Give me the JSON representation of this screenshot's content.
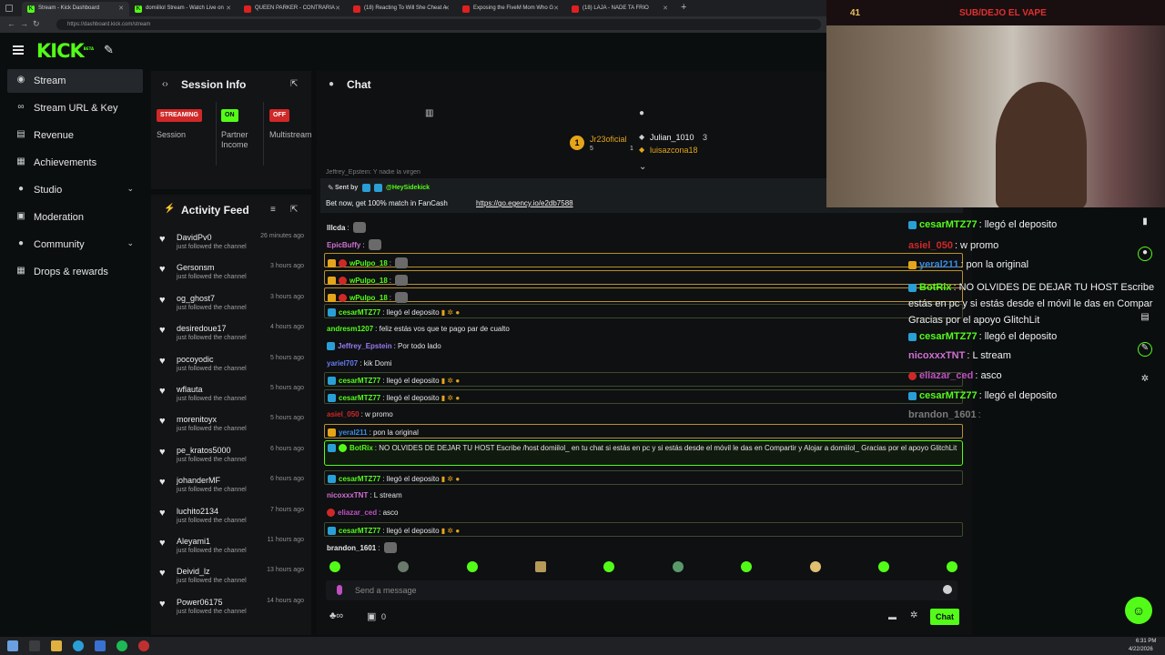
{
  "browser": {
    "tabs": [
      {
        "label": "Stream - Kick Dashboard",
        "active": true
      },
      {
        "label": "domiiliol Stream - Watch Live on",
        "active": false
      },
      {
        "label": "QUEEN PARKER - CONTRARIA",
        "active": false
      },
      {
        "label": "(18) Reacting To Will She Cheat A",
        "active": false
      },
      {
        "label": "Exposing the FiveM Mom Who G",
        "active": false
      },
      {
        "label": "(18) LAJA - NADE TA FRIO",
        "active": false
      }
    ],
    "url": "https://dashboard.kick.com/stream"
  },
  "kick": {
    "logo": "KICK",
    "logo_sup": "BETA"
  },
  "sidebar": {
    "items": [
      {
        "label": "Stream",
        "icon": "broadcast-icon"
      },
      {
        "label": "Stream URL & Key",
        "icon": "link-icon"
      },
      {
        "label": "Revenue",
        "icon": "dollar-icon"
      },
      {
        "label": "Achievements",
        "icon": "trophy-icon"
      },
      {
        "label": "Studio",
        "icon": "studio-icon"
      },
      {
        "label": "Moderation",
        "icon": "shield-icon"
      },
      {
        "label": "Community",
        "icon": "community-icon"
      },
      {
        "label": "Drops & rewards",
        "icon": "gift-icon"
      }
    ]
  },
  "session": {
    "title": "Session Info",
    "items": [
      {
        "badge": "STREAMING",
        "label": "Session",
        "color": "#d02828"
      },
      {
        "badge": "ON",
        "label": "Partner Income",
        "color": "#53fc18"
      },
      {
        "badge": "OFF",
        "label": "Multistream",
        "color": "#d02828"
      }
    ]
  },
  "activity": {
    "title": "Activity Feed",
    "sub": "just followed the channel",
    "rows": [
      {
        "name": "DavidPv0",
        "time": "26 minutes ago"
      },
      {
        "name": "Gersonsm",
        "time": "3 hours ago"
      },
      {
        "name": "og_ghost7",
        "time": "3 hours ago"
      },
      {
        "name": "desiredoue17",
        "time": "4 hours ago"
      },
      {
        "name": "pocoyodic",
        "time": "5 hours ago"
      },
      {
        "name": "wflauta",
        "time": "5 hours ago"
      },
      {
        "name": "morenitoyx",
        "time": "5 hours ago"
      },
      {
        "name": "pe_kratos5000",
        "time": "6 hours ago"
      },
      {
        "name": "johanderMF",
        "time": "6 hours ago"
      },
      {
        "name": "luchito2134",
        "time": "7 hours ago"
      },
      {
        "name": "Aleyami1",
        "time": "11 hours ago"
      },
      {
        "name": "Deivid_lz",
        "time": "13 hours ago"
      },
      {
        "name": "Power06175",
        "time": "14 hours ago"
      }
    ]
  },
  "chat": {
    "title": "Chat",
    "top_gifters": {
      "first": {
        "name": "Jr23oficial",
        "count": "5"
      },
      "second": {
        "name": "Julian_1010",
        "count": "3"
      },
      "third": {
        "name": "luisazcona18",
        "count": "1"
      }
    },
    "partial_top": "Jeffrey_Epstein: Y nadie la virgen",
    "pinned": {
      "sent_by": "Sent by",
      "sender": "@HeySidekick",
      "text": "Bet now, get 100% match in FanCash",
      "link": "https://go.egency.io/e2db7588"
    },
    "messages": [
      {
        "name": "lllcda",
        "text": "",
        "color": "#e8e8e8"
      },
      {
        "name": "EpicBuffy",
        "text": "",
        "color": "#d070d0"
      },
      {
        "name": "wPulpo_18",
        "text": "",
        "color": "#53fc18"
      },
      {
        "name": "wPulpo_18",
        "text": "",
        "color": "#53fc18"
      },
      {
        "name": "wPulpo_18",
        "text": "",
        "color": "#53fc18"
      },
      {
        "name": "cesarMTZ77",
        "text": "llegó el deposito",
        "color": "#53fc18"
      },
      {
        "name": "andresm1207",
        "text": "feliz estás vos que te pago par de cualto",
        "color": "#53fc18"
      },
      {
        "name": "Jeffrey_Epstein",
        "text": "Por todo lado",
        "color": "#9a7cf0"
      },
      {
        "name": "yariel707",
        "text": "kik Domi",
        "color": "#6a7cf0"
      },
      {
        "name": "cesarMTZ77",
        "text": "llegó el deposito",
        "color": "#53fc18"
      },
      {
        "name": "cesarMTZ77",
        "text": "llegó el deposito",
        "color": "#53fc18"
      },
      {
        "name": "asiel_050",
        "text": "w promo",
        "color": "#d02828"
      },
      {
        "name": "yeral211",
        "text": "pon la original",
        "color": "#3a8ae0"
      },
      {
        "name": "BotRix",
        "text": "NO OLVIDES DE DEJAR TU HOST Escribe /host domiilol_ en tu chat si estás en pc y si estás desde el móvil le das en Compartir y Alojar a domiilol_ Gracias por el apoyo GlitchLit",
        "color": "#53fc18"
      },
      {
        "name": "cesarMTZ77",
        "text": "llegó el deposito",
        "color": "#53fc18"
      },
      {
        "name": "nicoxxxTNT",
        "text": "L stream",
        "color": "#d070d0"
      },
      {
        "name": "eliazar_ced",
        "text": "asco",
        "color": "#c050c0"
      },
      {
        "name": "cesarMTZ77",
        "text": "llegó el deposito",
        "color": "#53fc18"
      },
      {
        "name": "brandon_1601",
        "text": "",
        "color": "#e8e8e8"
      }
    ],
    "input_placeholder": "Send a message",
    "viewer_count": "0",
    "send_label": "Chat"
  },
  "overlay": {
    "cam_title": "SUB/DEJO EL VAPE",
    "cam_count": "41",
    "messages": [
      {
        "name": "cesarMTZ77",
        "text": ": llegó el deposito",
        "color": "#53fc18"
      },
      {
        "name": "asiel_050",
        "text": ": w promo",
        "color": "#d02828"
      },
      {
        "name": "yeral211",
        "text": ": pon la original",
        "color": "#3a8ae0"
      },
      {
        "name": "BotRix",
        "text": ": NO OLVIDES DE DEJAR TU HOST Escribe estás en pc y si estás desde el móvil le das en Compar Gracias por el apoyo GlitchLit",
        "color": "#53fc18"
      },
      {
        "name": "cesarMTZ77",
        "text": ": llegó el deposito",
        "color": "#53fc18"
      },
      {
        "name": "nicoxxxTNT",
        "text": ": L stream",
        "color": "#d070d0"
      },
      {
        "name": "eliazar_ced",
        "text": ": asco",
        "color": "#c050c0"
      },
      {
        "name": "cesarMTZ77",
        "text": ": llegó el deposito",
        "color": "#53fc18"
      },
      {
        "name": "brandon_1601",
        "text": ":",
        "color": "#7a7a7a"
      }
    ]
  },
  "taskbar": {
    "time": "6:31 PM",
    "date": "4/22/2026"
  }
}
